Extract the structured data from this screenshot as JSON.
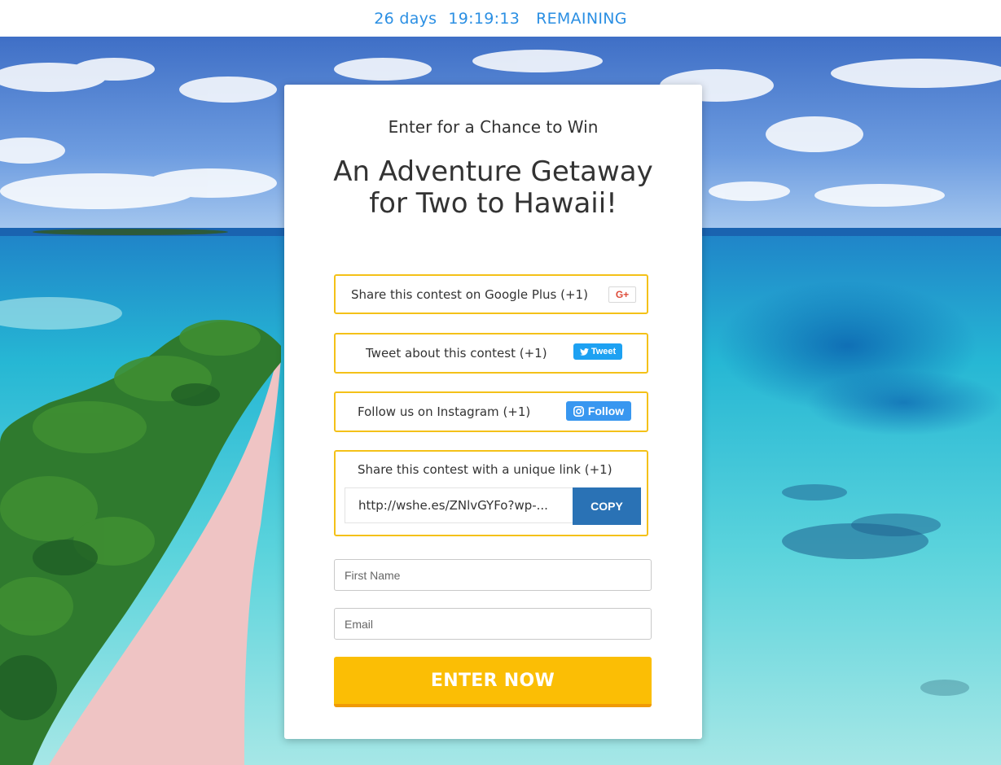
{
  "timer": {
    "days": "26 days",
    "time": "19:19:13",
    "remaining": "REMAINING"
  },
  "card": {
    "subtitle": "Enter for a Chance to Win",
    "title": "An Adventure Getaway for Two to Hawaii!"
  },
  "actions": {
    "google": {
      "label": "Share this contest on Google Plus (+1)",
      "button": "G+"
    },
    "twitter": {
      "label": "Tweet about this contest (+1)",
      "button": "Tweet"
    },
    "instagram": {
      "label": "Follow us on Instagram (+1)",
      "button": "Follow"
    },
    "link": {
      "label": "Share this contest with a unique link (+1)",
      "url": "http://wshe.es/ZNlvGYFo?wp-...",
      "button": "COPY"
    }
  },
  "form": {
    "first_name_placeholder": "First Name",
    "email_placeholder": "Email",
    "submit_label": "ENTER NOW"
  },
  "colors": {
    "timer": "#2b8fe3",
    "action_border": "#f4c118",
    "copy_button": "#2a72b5",
    "enter_button": "#fbbe05",
    "twitter": "#1da1f2",
    "instagram": "#3897f0",
    "google_plus": "#dd4b39"
  },
  "icons": [
    "google-plus-icon",
    "twitter-bird-icon",
    "instagram-icon"
  ]
}
